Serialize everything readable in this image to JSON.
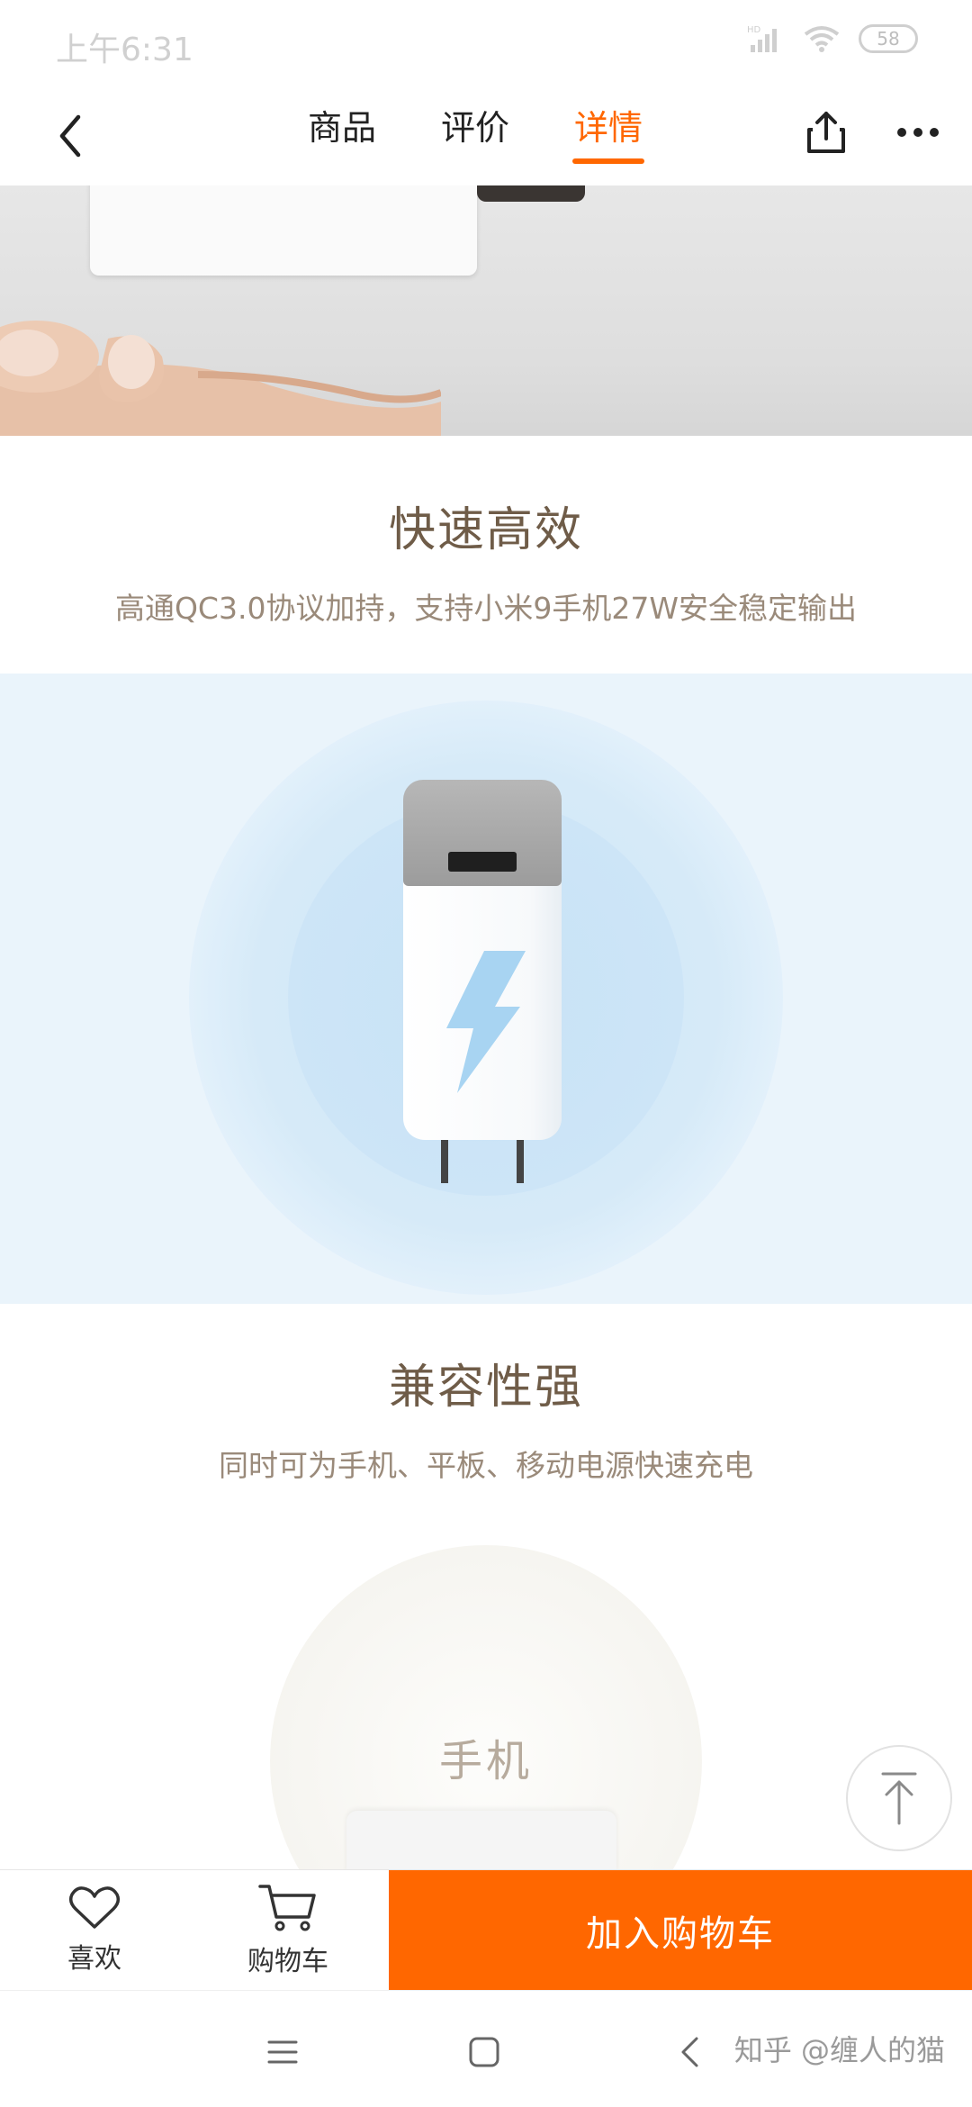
{
  "status_bar": {
    "time": "上午6:31",
    "network_badge": "HD",
    "battery": "58"
  },
  "nav": {
    "tabs": [
      {
        "label": "商品",
        "active": false
      },
      {
        "label": "评价",
        "active": false
      },
      {
        "label": "详情",
        "active": true
      }
    ],
    "accent_color": "#ff6700"
  },
  "sections": {
    "fast": {
      "title": "快速高效",
      "subtitle": "高通QC3.0协议加持，支持小米9手机27W安全稳定输出"
    },
    "compat": {
      "title": "兼容性强",
      "subtitle": "同时可为手机、平板、移动电源快速充电"
    },
    "device_label": "手机"
  },
  "action_bar": {
    "like_label": "喜欢",
    "cart_label": "购物车",
    "add_to_cart_label": "加入购物车"
  },
  "watermark": "知乎 @缠人的猫",
  "icons": [
    "back-icon",
    "share-icon",
    "more-icon",
    "heart-icon",
    "cart-icon",
    "scroll-top-icon",
    "menu-icon",
    "home-icon",
    "back-nav-icon",
    "signal-icon",
    "wifi-icon",
    "lightning-bolt-icon"
  ]
}
